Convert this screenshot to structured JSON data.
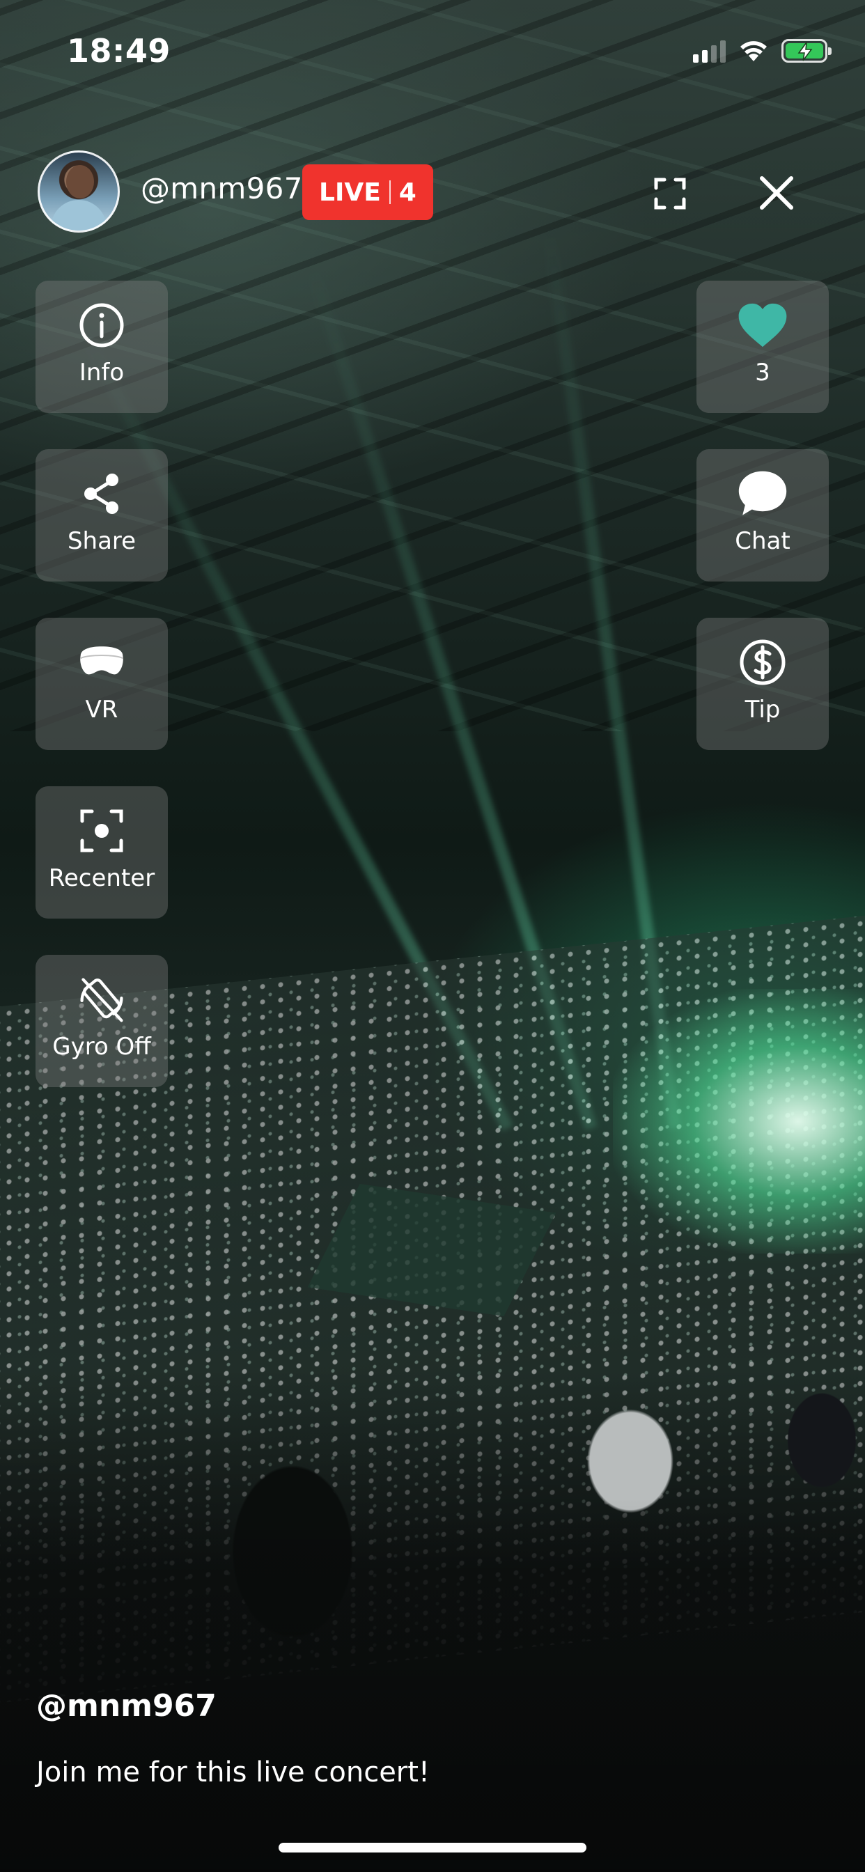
{
  "status_bar": {
    "time": "18:49",
    "signal_bars_active": 2,
    "signal_bars_total": 4,
    "battery_level": 1.0,
    "battery_charging": true,
    "icons": [
      "signal-icon",
      "wifi-icon",
      "battery-charging-icon"
    ]
  },
  "stream": {
    "handle": "@mnm967",
    "live_label": "LIVE",
    "viewer_count": "4",
    "live_color": "#f0332d"
  },
  "left_actions": [
    {
      "label": "Info",
      "icon": "info-icon"
    },
    {
      "label": "Share",
      "icon": "share-icon"
    },
    {
      "label": "VR",
      "icon": "vr-headset-icon"
    },
    {
      "label": "Recenter",
      "icon": "recenter-icon"
    },
    {
      "label": "Gyro Off",
      "icon": "gyro-off-icon"
    }
  ],
  "right_actions": [
    {
      "label": "3",
      "icon": "heart-icon",
      "color": "#3fb7a6"
    },
    {
      "label": "Chat",
      "icon": "chat-bubble-icon"
    },
    {
      "label": "Tip",
      "icon": "dollar-coin-icon"
    }
  ],
  "caption": {
    "handle": "@mnm967",
    "text": "Join me for this live concert!"
  },
  "top_controls": {
    "fullscreen_icon": "fullscreen-icon",
    "close_icon": "close-icon"
  }
}
